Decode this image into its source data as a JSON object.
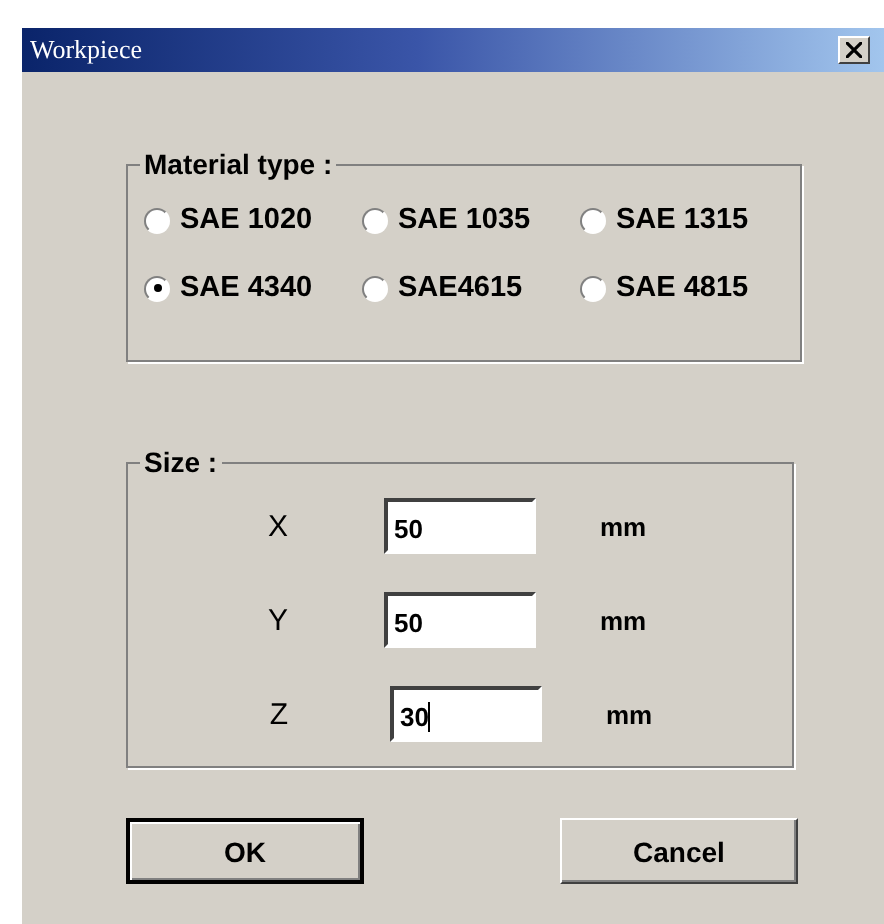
{
  "window": {
    "title": "Workpiece"
  },
  "material_type": {
    "label": "Material type :",
    "options": [
      {
        "label": "SAE 1020",
        "selected": false
      },
      {
        "label": "SAE 1035",
        "selected": false
      },
      {
        "label": "SAE 1315",
        "selected": false
      },
      {
        "label": "SAE 4340",
        "selected": true
      },
      {
        "label": "SAE4615",
        "selected": false
      },
      {
        "label": "SAE 4815",
        "selected": false
      }
    ]
  },
  "size": {
    "label": "Size :",
    "fields": [
      {
        "label": "X",
        "value": "50",
        "unit": "mm",
        "focused": false
      },
      {
        "label": "Y",
        "value": "50",
        "unit": "mm",
        "focused": false
      },
      {
        "label": "Z",
        "value": "30",
        "unit": "mm",
        "focused": true
      }
    ]
  },
  "buttons": [
    {
      "label": "OK",
      "default": true
    },
    {
      "label": "Cancel",
      "default": false
    }
  ]
}
